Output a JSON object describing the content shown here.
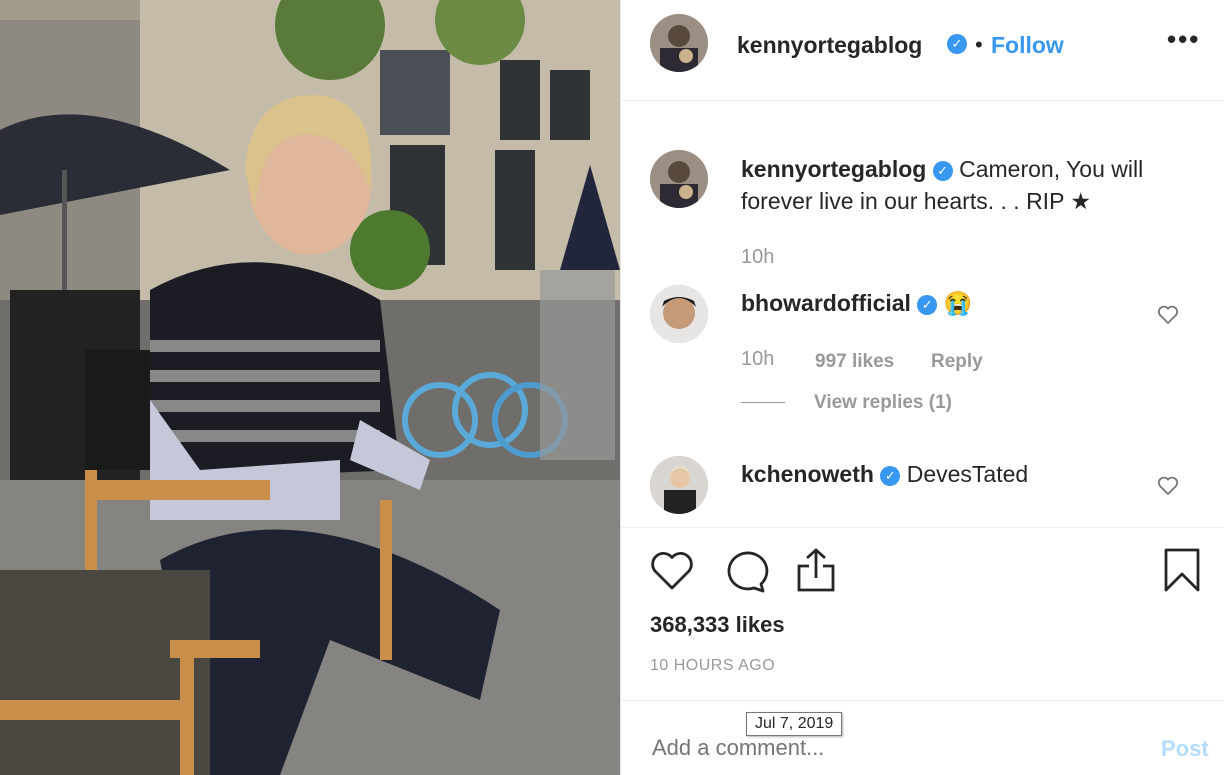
{
  "post": {
    "author": "kennyortegablog",
    "follow_label": "Follow",
    "dot": "•",
    "more_label": "•••",
    "caption_text": "Cameron, You will forever live in our hearts. . . RIP ★",
    "caption_time": "10h"
  },
  "comments": [
    {
      "username": "bhowardofficial",
      "text": "😭",
      "time": "10h",
      "likes": "997 likes",
      "reply_label": "Reply",
      "view_replies": "View replies (1)"
    },
    {
      "username": "kchenoweth",
      "text": "DevesTated"
    }
  ],
  "likes_count": "368,333 likes",
  "time_ago": "10 HOURS AGO",
  "tooltip_date": "Jul 7, 2019",
  "comment_input": {
    "placeholder": "Add a comment..."
  },
  "post_button": "Post",
  "colors": {
    "accent": "#3897f0",
    "post_disabled": "#b3dbff"
  }
}
